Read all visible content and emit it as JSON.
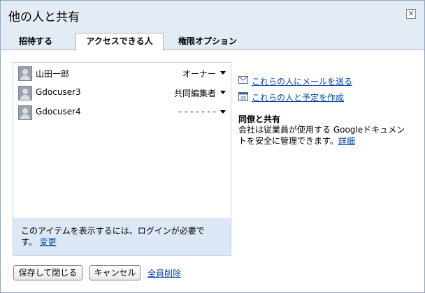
{
  "dialog": {
    "title": "他の人と共有",
    "close_glyph": "✕"
  },
  "tabs": [
    {
      "label": "招待する",
      "active": false
    },
    {
      "label": "アクセスできる人",
      "active": true
    },
    {
      "label": "権限オプション",
      "active": false
    }
  ],
  "people": [
    {
      "name": "山田一郎",
      "role": "オーナー"
    },
    {
      "name": "Gdocuser3",
      "role": "共同編集者"
    },
    {
      "name": "Gdocuser4",
      "role": "- - - - - - -"
    }
  ],
  "notice": {
    "text": "このアイテムを表示するには、ログインが必要です。",
    "link": "変更"
  },
  "actions": {
    "email": "これらの人にメールを送る",
    "calendar": "これらの人と予定を作成"
  },
  "share_info": {
    "title": "同僚と共有",
    "text": "会社は従業員が使用する Googleドキュメントを安全に管理できます。",
    "link": "詳細"
  },
  "buttons": {
    "save": "保存して閉じる",
    "cancel": "キャンセル",
    "remove_all": "全員削除"
  },
  "colors": {
    "header_bg": "#e3ebf5",
    "notice_bg": "#dde8f6",
    "link": "#0645ad",
    "border": "#8fa6c1"
  }
}
